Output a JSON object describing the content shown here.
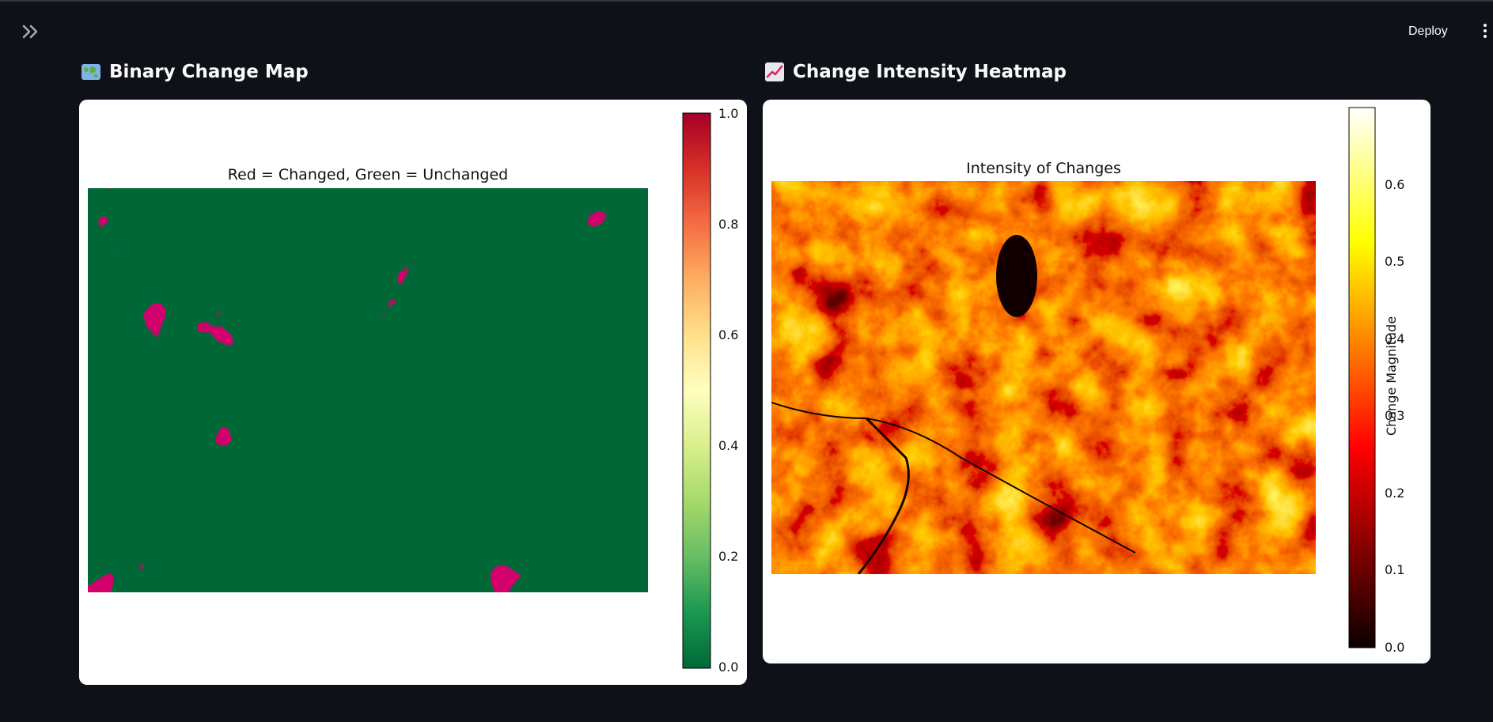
{
  "toolbar": {
    "deploy_label": "Deploy",
    "sidebar_toggle_icon": "double-chevron-right-icon",
    "menu_icon": "kebab-menu-icon"
  },
  "colors": {
    "background": "#0e1117",
    "card": "#ffffff",
    "changed": "#a50026",
    "unchanged": "#006837"
  },
  "left": {
    "title": "Binary Change Map",
    "title_icon": "world-map-icon",
    "chart_data": {
      "type": "heatmap",
      "title": "Red = Changed, Green = Unchanged",
      "colormap": "RdYlGn_r",
      "values_shown": [
        0,
        1
      ],
      "colorbar": {
        "range": [
          0.0,
          1.0
        ],
        "ticks": [
          "0.0",
          "0.2",
          "0.4",
          "0.6",
          "0.8",
          "1.0"
        ]
      },
      "axes_visible": false
    }
  },
  "right": {
    "title": "Change Intensity Heatmap",
    "title_icon": "chart-increasing-icon",
    "chart_data": {
      "type": "heatmap",
      "title": "Intensity of Changes",
      "colormap": "hot",
      "colorbar": {
        "label": "Change Magnitude",
        "range": [
          0.0,
          0.7
        ],
        "ticks": [
          "0.0",
          "0.1",
          "0.2",
          "0.3",
          "0.4",
          "0.5",
          "0.6"
        ]
      },
      "axes_visible": false
    }
  }
}
